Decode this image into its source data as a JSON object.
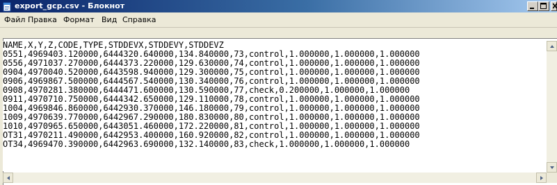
{
  "window": {
    "title": "export_gcp.csv - Блокнот",
    "title_bar_colors": {
      "start": "#0a246a",
      "end": "#a6caf0"
    }
  },
  "menubar": {
    "items": [
      "Файл",
      "Правка",
      "Формат",
      "Вид",
      "Справка"
    ]
  },
  "document": {
    "lines": [
      "NAME,X,Y,Z,CODE,TYPE,STDDEVX,STDDEVY,STDDEVZ",
      "0551,4969403.120000,6444320.640000,134.840000,73,control,1.000000,1.000000,1.000000",
      "0556,4971037.270000,6444373.220000,129.630000,74,control,1.000000,1.000000,1.000000",
      "0904,4970040.520000,6443598.940000,129.300000,75,control,1.000000,1.000000,1.000000",
      "0906,4969867.500000,6444567.540000,130.340000,76,control,1.000000,1.000000,1.000000",
      "0908,4970281.380000,6444471.600000,130.590000,77,check,0.200000,1.000000,1.000000",
      "0911,4970710.750000,6444342.650000,129.110000,78,control,1.000000,1.000000,1.000000",
      "1004,4969846.860000,6442930.370000,146.180000,79,control,1.000000,1.000000,1.000000",
      "1009,4970639.770000,6442967.290000,180.830000,80,control,1.000000,1.000000,1.000000",
      "1010,4970965.650000,6443051.460000,172.220000,81,control,1.000000,1.000000,1.000000",
      "OT31,4970211.490000,6442953.400000,160.920000,82,control,1.000000,1.000000,1.000000",
      "OT34,4969470.390000,6442963.690000,132.140000,83,check,1.000000,1.000000,1.000000"
    ]
  },
  "icons": {
    "app": "notepad-icon",
    "minimize": "minimize-icon",
    "maximize": "maximize-icon",
    "close": "close-icon",
    "scroll_up": "scroll-up-arrow-icon",
    "scroll_down": "scroll-down-arrow-icon",
    "scroll_left": "scroll-left-arrow-icon",
    "scroll_right": "scroll-right-arrow-icon"
  }
}
